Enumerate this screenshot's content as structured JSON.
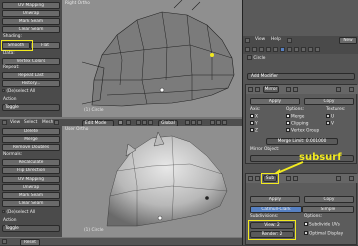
{
  "left_toolbar_top": {
    "items": [
      "UV Mapping",
      "Unwrap",
      "Mark Seam",
      "Clear Seam",
      "Shading:",
      "Smooth",
      "Flat",
      "Data:",
      "Vertex Colors",
      "Repeat:",
      "Repeat Last",
      "History..."
    ],
    "grease_pencil": "(De)select All",
    "action_label": "Action",
    "action_value": "Toggle",
    "reset": "Reset"
  },
  "left_toolbar_bottom": {
    "items": [
      "Delete",
      "Merge",
      "Remove Doubles",
      "Normals:",
      "Recalculate",
      "Flip Direction",
      "UV Mapping",
      "Unwrap",
      "Mark Seam",
      "Clear Seam"
    ],
    "select_all": "(De)select All",
    "action_label": "Action",
    "action_value": "Toggle",
    "reset": "Reset"
  },
  "viewport_top": {
    "label": "Right Ortho",
    "object": "(1) Circle"
  },
  "viewport_bottom": {
    "label": "User Ortho",
    "object": "(1) Circle"
  },
  "header_bar": {
    "view": "View",
    "select": "Select",
    "mesh": "Mesh",
    "mode": "Edit Mode",
    "pivot": "Global"
  },
  "properties": {
    "top_menu": [
      "View",
      "Help",
      "New"
    ],
    "object_name": "Circle",
    "add_modifier": "Add Modifier",
    "mirror_modifier": {
      "name": "Mirror",
      "apply": "Apply",
      "copy": "Copy",
      "axis_label": "Axis:",
      "options_label": "Options:",
      "textures_label": "Textures:",
      "axes": [
        "X",
        "Y",
        "Z"
      ],
      "options": [
        "Merge",
        "Clipping",
        "Vertex Group"
      ],
      "textures": [
        "U",
        "V"
      ],
      "merge_limit": "Merge Limit: 0.001000",
      "mirror_object_label": "Mirror Object:"
    },
    "subsurf_modifier": {
      "name": "Sub",
      "apply": "Apply",
      "copy": "Copy",
      "tab_catmull": "Catmull-Clark",
      "tab_simple": "Simple",
      "subdivisions_label": "Subdivisions:",
      "options_label": "Options:",
      "view_value": "View: 2",
      "render_value": "Render: 2",
      "subdivide_uvs": "Subdivide UVs",
      "optimal_display": "Optimal Display"
    }
  },
  "annotation": {
    "text": "subsurf",
    "color": "#f2ea1f"
  },
  "colors": {
    "highlight": "#f2ea1f",
    "accent_blue": "#5680c2",
    "viewport_bg": "#8f8f8f"
  }
}
